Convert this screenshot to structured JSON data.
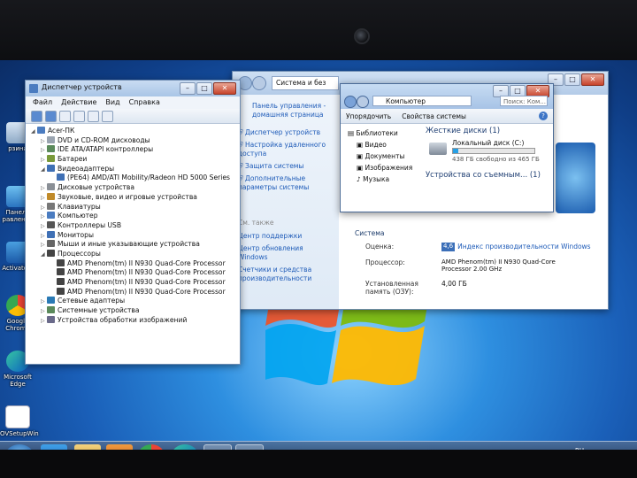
{
  "device_manager": {
    "title": "Диспетчер устройств",
    "menu": [
      "Файл",
      "Действие",
      "Вид",
      "Справка"
    ],
    "tree": [
      {
        "label": "Acer-ПК",
        "level": 0,
        "exp": "◢",
        "icon": "computer"
      },
      {
        "label": "DVD и CD-ROM дисководы",
        "level": 1,
        "exp": "▷",
        "icon": "dvd"
      },
      {
        "label": "IDE ATA/ATAPI контроллеры",
        "level": 1,
        "exp": "▷",
        "icon": "chip"
      },
      {
        "label": "Батареи",
        "level": 1,
        "exp": "▷",
        "icon": "battery"
      },
      {
        "label": "Видеоадаптеры",
        "level": 1,
        "exp": "◢",
        "icon": "display"
      },
      {
        "label": "(PE64) AMD/ATI Mobility/Radeon HD 5000 Series",
        "level": 2,
        "exp": "",
        "icon": "display"
      },
      {
        "label": "Дисковые устройства",
        "level": 1,
        "exp": "▷",
        "icon": "disk"
      },
      {
        "label": "Звуковые, видео и игровые устройства",
        "level": 1,
        "exp": "▷",
        "icon": "sound"
      },
      {
        "label": "Клавиатуры",
        "level": 1,
        "exp": "▷",
        "icon": "keyboard"
      },
      {
        "label": "Компьютер",
        "level": 1,
        "exp": "▷",
        "icon": "computer"
      },
      {
        "label": "Контроллеры USB",
        "level": 1,
        "exp": "▷",
        "icon": "usb"
      },
      {
        "label": "Мониторы",
        "level": 1,
        "exp": "▷",
        "icon": "monitor"
      },
      {
        "label": "Мыши и иные указывающие устройства",
        "level": 1,
        "exp": "▷",
        "icon": "mouse"
      },
      {
        "label": "Процессоры",
        "level": 1,
        "exp": "◢",
        "icon": "cpu"
      },
      {
        "label": "AMD Phenom(tm) II N930 Quad-Core Processor",
        "level": 2,
        "exp": "",
        "icon": "cpu"
      },
      {
        "label": "AMD Phenom(tm) II N930 Quad-Core Processor",
        "level": 2,
        "exp": "",
        "icon": "cpu"
      },
      {
        "label": "AMD Phenom(tm) II N930 Quad-Core Processor",
        "level": 2,
        "exp": "",
        "icon": "cpu"
      },
      {
        "label": "AMD Phenom(tm) II N930 Quad-Core Processor",
        "level": 2,
        "exp": "",
        "icon": "cpu"
      },
      {
        "label": "Сетевые адаптеры",
        "level": 1,
        "exp": "▷",
        "icon": "network"
      },
      {
        "label": "Системные устройства",
        "level": 1,
        "exp": "▷",
        "icon": "chip"
      },
      {
        "label": "Устройства обработки изображений",
        "level": 1,
        "exp": "▷",
        "icon": "camera"
      }
    ]
  },
  "system_window": {
    "breadcrumb": "Система и без",
    "left_links": [
      "Панель управления - домашняя страница",
      "Диспетчер устройств",
      "Настройка удаленного доступа",
      "Защита системы",
      "Дополнительные параметры системы"
    ],
    "see_also": "См. также",
    "see_also_links": [
      "Центр поддержки",
      "Центр обновления Windows",
      "Счетчики и средства производительности"
    ],
    "section": "Система",
    "rows": [
      {
        "label": "Оценка:",
        "value": "Индекс производительности Windows",
        "badge": "4,6"
      },
      {
        "label": "Процессор:",
        "value": "AMD Phenom(tm) II N930 Quad-Core Processor 2.00 GHz"
      },
      {
        "label": "Установленная память (ОЗУ):",
        "value": "4,00 ГБ"
      }
    ]
  },
  "explorer": {
    "address": "Компьютер",
    "search_placeholder": "Поиск: Ком...",
    "toolbar": [
      "Упорядочить",
      "Свойства системы"
    ],
    "nav": [
      "Библиотеки",
      "Видео",
      "Документы",
      "Изображения",
      "Музыка"
    ],
    "group_hdd": "Жесткие диски (1)",
    "drive_name": "Локальный диск (C:)",
    "drive_free": "438 ГБ свободно из 465 ГБ",
    "drive_used_fraction": 0.06,
    "group_removable": "Устройства со съемным... (1)"
  },
  "desktop_icons": [
    "рзина",
    "Панель равления",
    "Activators",
    "Google Chrome",
    "Microsoft Edge",
    "OVSetupWin"
  ],
  "taskbar": {
    "clock": "RU",
    "items": [
      "start",
      "ie",
      "explorer",
      "media",
      "chrome",
      "edge",
      "devmgr",
      "explorer2"
    ]
  },
  "colors": {
    "accent": "#1e5bb8",
    "title": "#b7cfeb"
  }
}
